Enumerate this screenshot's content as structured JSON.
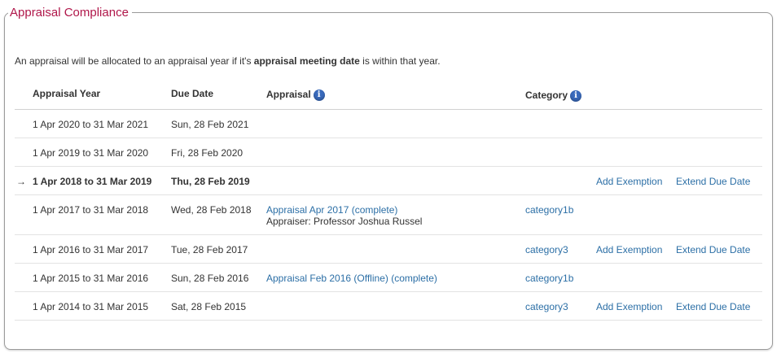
{
  "panel": {
    "title": "Appraisal Compliance",
    "intro_before": "An appraisal will be allocated to an appraisal year if it's ",
    "intro_bold": "appraisal meeting date",
    "intro_after": " is within that year."
  },
  "table": {
    "headers": {
      "appraisal_year": "Appraisal Year",
      "due_date": "Due Date",
      "appraisal": "Appraisal",
      "category": "Category"
    },
    "info_icon_glyph": "i",
    "current_marker": "→",
    "rows": [
      {
        "year": "1 Apr 2020 to 31 Mar 2021",
        "due": "Sun, 28 Feb 2021",
        "appraisal": "",
        "appraiser": "",
        "category": "",
        "add_exemption": "",
        "extend_due_date": ""
      },
      {
        "year": "1 Apr 2019 to 31 Mar 2020",
        "due": "Fri, 28 Feb 2020",
        "appraisal": "",
        "appraiser": "",
        "category": "",
        "add_exemption": "",
        "extend_due_date": ""
      },
      {
        "year": "1 Apr 2018 to 31 Mar 2019",
        "due": "Thu, 28 Feb 2019",
        "appraisal": "",
        "appraiser": "",
        "category": "",
        "add_exemption": "Add Exemption",
        "extend_due_date": "Extend Due Date"
      },
      {
        "year": "1 Apr 2017 to 31 Mar 2018",
        "due": "Wed, 28 Feb 2018",
        "appraisal": "Appraisal Apr 2017 (complete)",
        "appraiser": "Appraiser: Professor Joshua Russel",
        "category": "category1b",
        "add_exemption": "",
        "extend_due_date": ""
      },
      {
        "year": "1 Apr 2016 to 31 Mar 2017",
        "due": "Tue, 28 Feb 2017",
        "appraisal": "",
        "appraiser": "",
        "category": "category3",
        "add_exemption": "Add Exemption",
        "extend_due_date": "Extend Due Date"
      },
      {
        "year": "1 Apr 2015 to 31 Mar 2016",
        "due": "Sun, 28 Feb 2016",
        "appraisal": "Appraisal Feb 2016 (Offline) (complete)",
        "appraiser": "",
        "category": "category1b",
        "add_exemption": "",
        "extend_due_date": ""
      },
      {
        "year": "1 Apr 2014 to 31 Mar 2015",
        "due": "Sat, 28 Feb 2015",
        "appraisal": "",
        "appraiser": "",
        "category": "category3",
        "add_exemption": "Add Exemption",
        "extend_due_date": "Extend Due Date"
      }
    ]
  },
  "colors": {
    "title": "#b0174a",
    "link": "#2c6fa6",
    "info_icon": "#3a6bbd"
  }
}
